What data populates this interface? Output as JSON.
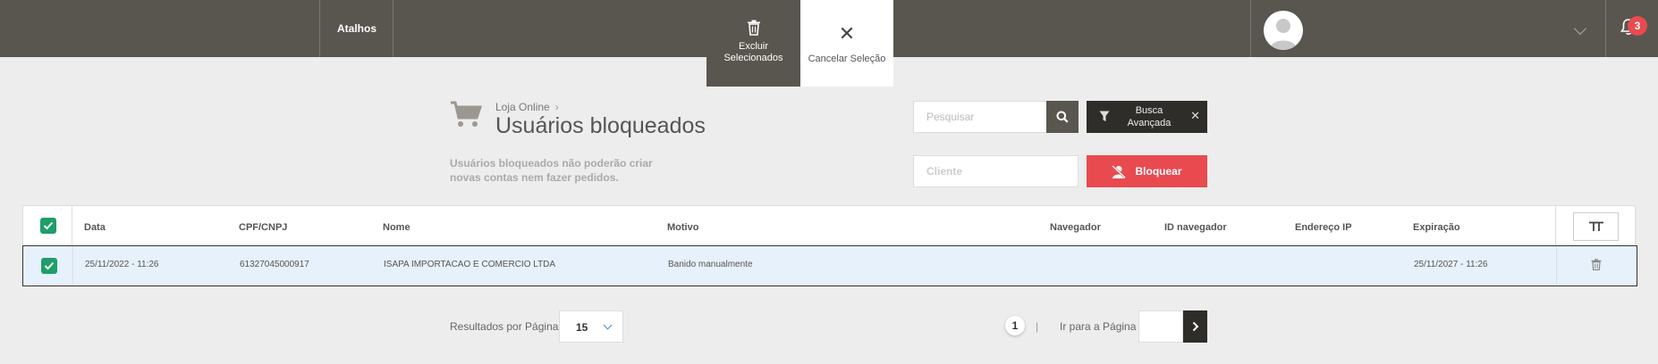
{
  "topbar": {
    "shortcuts_label": "Atalhos",
    "delete_selected_line1": "Excluir",
    "delete_selected_line2": "Selecionados",
    "cancel_selection_label": "Cancelar Seleção",
    "notification_count": "3"
  },
  "header": {
    "breadcrumb": "Loja Online",
    "title": "Usuários bloqueados",
    "description": "Usuários bloqueados não poderão criar novas contas nem fazer pedidos.",
    "search_placeholder": "Pesquisar",
    "advanced_search_label": "Busca Avançada",
    "client_placeholder": "Cliente",
    "block_button_label": "Bloquear"
  },
  "table": {
    "columns": {
      "data": "Data",
      "cpf": "CPF/CNPJ",
      "nome": "Nome",
      "motivo": "Motivo",
      "navegador": "Navegador",
      "id_navegador": "ID navegador",
      "endereco_ip": "Endereço IP",
      "expiracao": "Expiração"
    },
    "rows": [
      {
        "data": "25/11/2022 - 11:26",
        "cpf": "61327045000917",
        "nome": "ISAPA IMPORTACAO E COMERCIO LTDA",
        "motivo": "Banido manualmente",
        "navegador": "",
        "id_navegador": "",
        "endereco_ip": "",
        "expiracao": "25/11/2027 - 11:26",
        "selected": true
      }
    ]
  },
  "pagination": {
    "results_per_page_label": "Resultados por Página",
    "results_per_page_value": "15",
    "current_page": "1",
    "separator": "|",
    "go_to_page_label": "Ir para a Página"
  },
  "colors": {
    "topbar": "#58564e",
    "dark_button": "#2e2d29",
    "danger": "#e84a50",
    "checkbox": "#1e9e6a",
    "selected_row": "#e6f1fb"
  }
}
